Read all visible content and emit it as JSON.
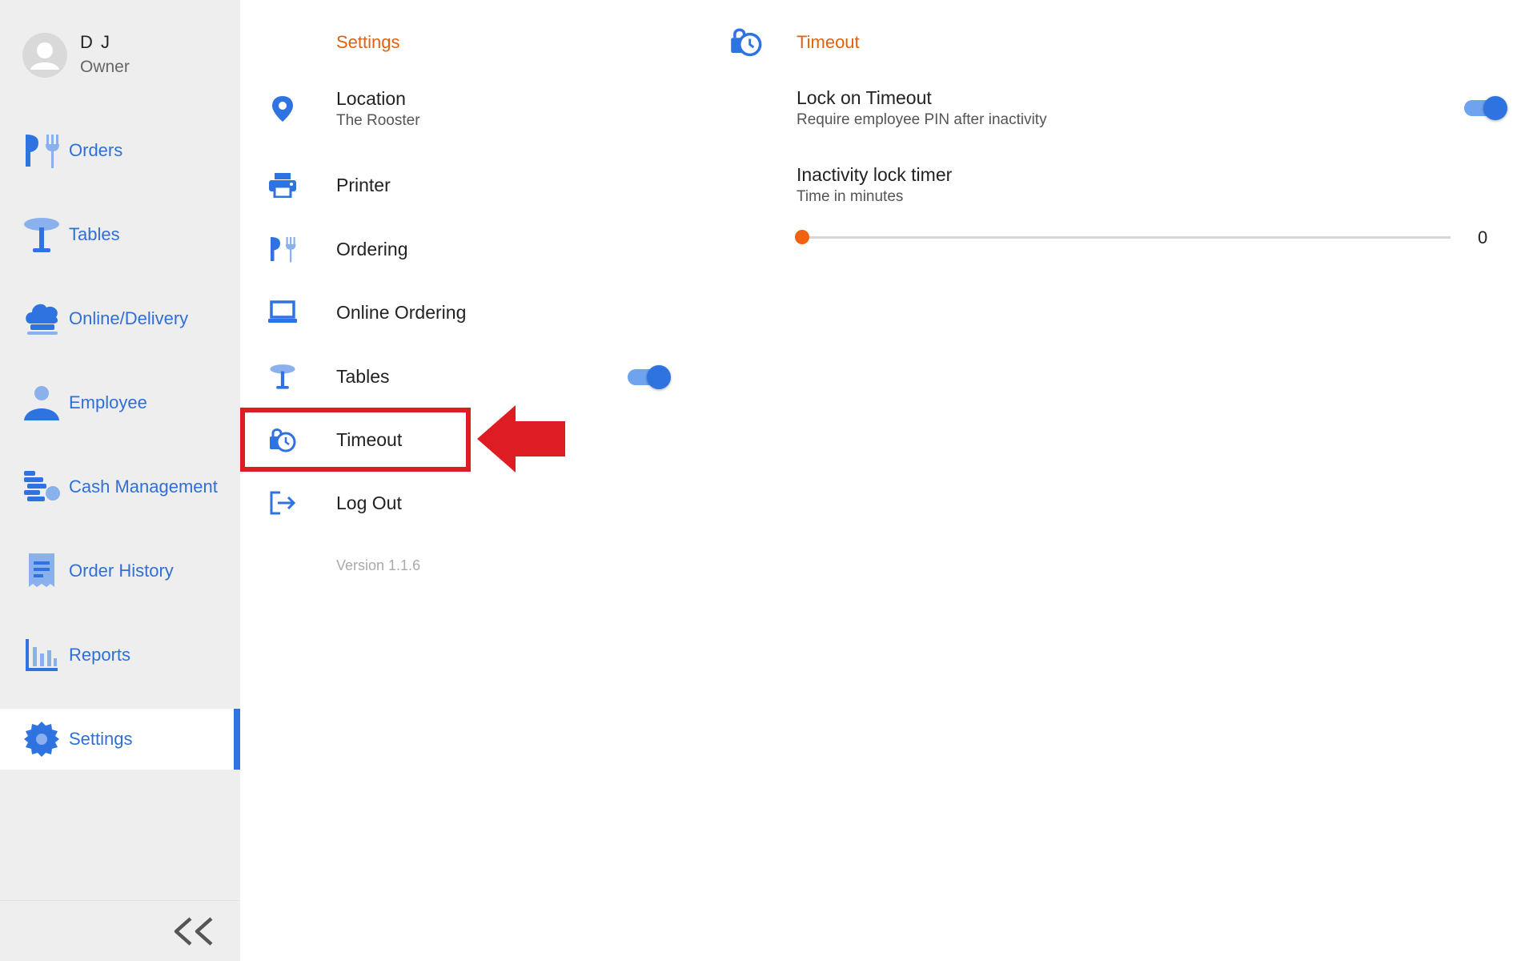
{
  "user": {
    "name": "D J",
    "role": "Owner"
  },
  "sidebar": {
    "items": [
      {
        "label": "Orders",
        "icon": "orders-icon"
      },
      {
        "label": "Tables",
        "icon": "table-icon"
      },
      {
        "label": "Online/Delivery",
        "icon": "chef-hat-icon"
      },
      {
        "label": "Employee",
        "icon": "person-icon"
      },
      {
        "label": "Cash Management",
        "icon": "cash-management-icon"
      },
      {
        "label": "Order History",
        "icon": "receipt-icon"
      },
      {
        "label": "Reports",
        "icon": "bar-chart-icon"
      },
      {
        "label": "Settings",
        "icon": "gear-icon",
        "active": true
      }
    ],
    "collapse_icon": "double-chevron-left-icon"
  },
  "settings": {
    "title": "Settings",
    "items": [
      {
        "label": "Location",
        "sublabel": "The Rooster",
        "icon": "location-pin-icon"
      },
      {
        "label": "Printer",
        "icon": "printer-icon"
      },
      {
        "label": "Ordering",
        "icon": "orders-icon"
      },
      {
        "label": "Online Ordering",
        "icon": "laptop-icon"
      },
      {
        "label": "Tables",
        "icon": "table-icon",
        "toggle": true
      },
      {
        "label": "Timeout",
        "icon": "lock-clock-icon",
        "selected": true
      },
      {
        "label": "Log Out",
        "icon": "logout-icon"
      }
    ],
    "version": "Version 1.1.6"
  },
  "detail": {
    "title": "Timeout",
    "icon": "lock-clock-icon",
    "lock_on_timeout": {
      "label": "Lock on Timeout",
      "sublabel": "Require employee PIN after inactivity",
      "enabled": true
    },
    "inactivity_timer": {
      "label": "Inactivity lock timer",
      "sublabel": "Time in minutes",
      "value": "0"
    }
  },
  "colors": {
    "accent_blue": "#2f73e0",
    "accent_orange": "#e0620f",
    "highlight_red": "#dd1c24"
  }
}
